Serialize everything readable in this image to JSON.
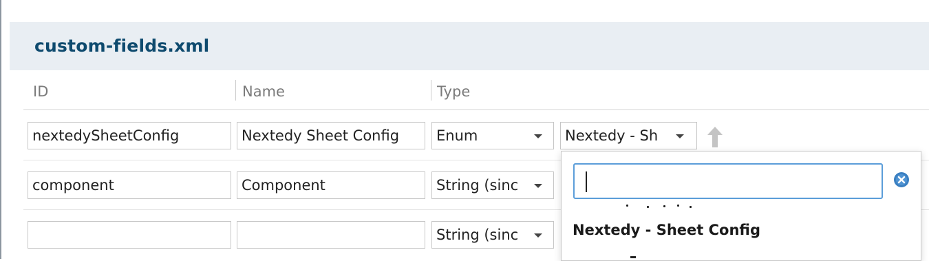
{
  "panel": {
    "title": "custom-fields.xml"
  },
  "columns": {
    "id": "ID",
    "name": "Name",
    "type": "Type"
  },
  "rows": [
    {
      "id": "nextedySheetConfig",
      "name": "Nextedy Sheet Config",
      "type": "Enum",
      "enum": "Nextedy - Sh"
    },
    {
      "id": "component",
      "name": "Component",
      "type": "String (sinc"
    },
    {
      "id": "",
      "name": "",
      "type": "String (sinc"
    }
  ],
  "dropdown": {
    "search_value": "",
    "options": [
      "Nextedy - Sheet Config"
    ]
  },
  "icons": {
    "move_up": "arrow-up-icon",
    "clear": "clear-circle-icon",
    "caret": "chevron-down-icon"
  },
  "colors": {
    "title": "#0e4a6e",
    "header_bg": "#e9eef3",
    "focus": "#5b9dd9",
    "clear_icon": "#3a7fc1"
  }
}
